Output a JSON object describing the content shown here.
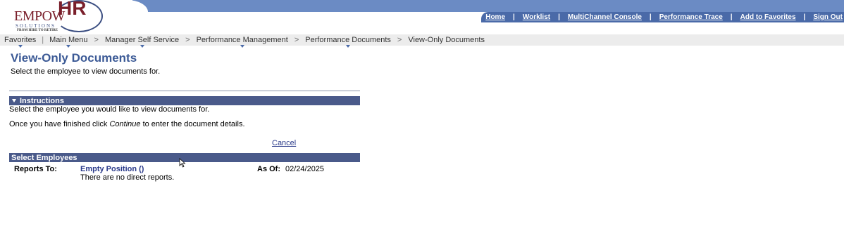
{
  "logo": {
    "word": "EMPOW",
    "hr": "HR",
    "sub": "SOLUTIONS",
    "tagline": "FROM HIRE TO RETIRE"
  },
  "nav": {
    "links": [
      "Home",
      "Worklist",
      "MultiChannel Console",
      "Performance Trace",
      "Add to Favorites",
      "Sign Out"
    ],
    "separator": "|"
  },
  "breadcrumb": {
    "favorites": "Favorites",
    "main_menu": "Main Menu",
    "items": [
      "Manager Self Service",
      "Performance Management",
      "Performance Documents"
    ],
    "current": "View-Only Documents",
    "pipe": "|",
    "arrow": ">"
  },
  "page": {
    "title": "View-Only Documents",
    "subtitle": "Select the employee to view documents for."
  },
  "instructions": {
    "header": "Instructions",
    "line1": "Select the employee you would like to view documents for.",
    "line2_prefix": "Once you have finished click ",
    "line2_emphasis": "Continue",
    "line2_suffix": " to enter the document details.",
    "cancel_label": "Cancel"
  },
  "employees": {
    "header": "Select Employees",
    "reports_to_label": "Reports To:",
    "reports_to_value": "Empty Position ()",
    "as_of_label": "As Of:",
    "as_of_value": "02/24/2025",
    "no_direct_message": "There are no direct reports."
  },
  "colors": {
    "header_band": "#6b8bc4",
    "nav_band": "#4a6aa8",
    "section_bar": "#4a5a8a",
    "title": "#3c5a96",
    "link": "#2a3a8a"
  }
}
